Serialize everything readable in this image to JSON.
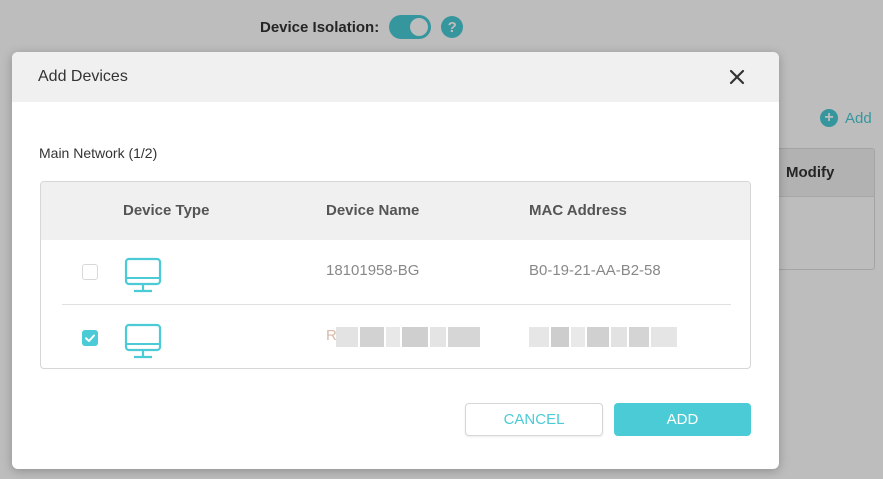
{
  "background": {
    "isolation_label": "Device Isolation:",
    "help_symbol": "?",
    "add_label": "Add",
    "table_header_modify": "Modify",
    "toggle_state": "on"
  },
  "modal": {
    "title": "Add Devices",
    "close_icon": "close-icon",
    "section_label": "Main Network   (1/2)",
    "columns": [
      "Device Type",
      "Device Name",
      "MAC Address"
    ],
    "rows": [
      {
        "checked": false,
        "icon": "computer-icon",
        "name": "18101958-BG",
        "mac": "B0-19-21-AA-B2-58"
      },
      {
        "checked": true,
        "icon": "computer-icon",
        "name": "R",
        "mac": ""
      }
    ],
    "cancel_label": "CANCEL",
    "add_label": "ADD"
  },
  "colors": {
    "accent": "#4acbd6",
    "header_bg": "#f0f0f0",
    "text": "#333333",
    "muted_text": "#888888"
  }
}
